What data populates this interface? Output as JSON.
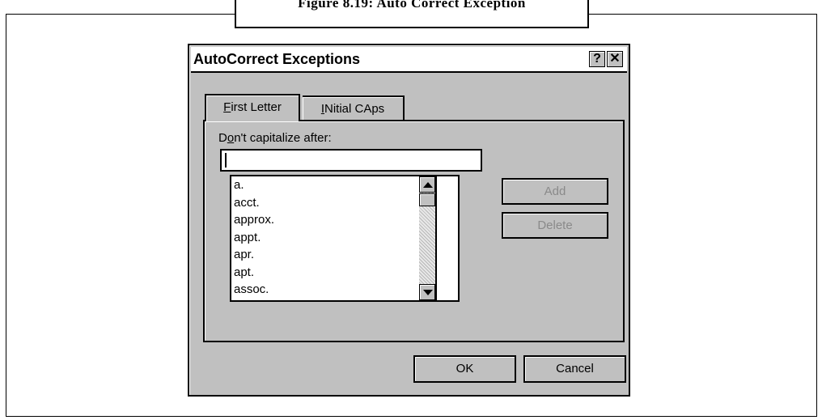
{
  "caption": "Figure 8.19: Auto Correct Exception",
  "dialog": {
    "title": "AutoCorrect Exceptions",
    "help_label": "?",
    "close_label": "✕"
  },
  "tabs": [
    {
      "label_mnemonic": "F",
      "label_rest": "irst Letter",
      "active": true
    },
    {
      "label_mnemonic": "I",
      "label_rest": "Nitial CAps",
      "active": false
    }
  ],
  "first_letter": {
    "field_label_pre": "D",
    "field_label_mnemonic": "o",
    "field_label_post": "n't capitalize after:",
    "input_value": "",
    "exceptions": [
      "a.",
      "acct.",
      "approx.",
      "appt.",
      "apr.",
      "apt.",
      "assoc."
    ],
    "add_label": "Add",
    "delete_label": "Delete",
    "add_enabled": false,
    "delete_enabled": false
  },
  "buttons": {
    "ok_label": "OK",
    "cancel_label": "Cancel"
  }
}
